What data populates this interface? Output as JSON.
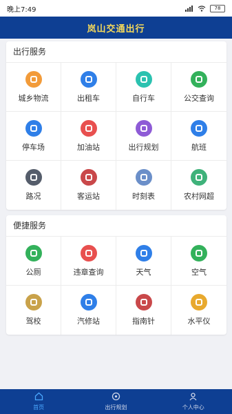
{
  "status_bar": {
    "time": "晚上7:49",
    "battery": "78"
  },
  "header": {
    "title": "岚山交通出行"
  },
  "sections": [
    {
      "title": "出行服务",
      "items": [
        {
          "label": "城乡物流",
          "icon": "logistics-icon",
          "color": "#f29b3a"
        },
        {
          "label": "出租车",
          "icon": "taxi-icon",
          "color": "#2f7fe8"
        },
        {
          "label": "自行车",
          "icon": "bicycle-icon",
          "color": "#2bc2b0"
        },
        {
          "label": "公交查询",
          "icon": "bus-icon",
          "color": "#33b15b"
        },
        {
          "label": "停车场",
          "icon": "parking-icon",
          "color": "#2f7fe8"
        },
        {
          "label": "加油站",
          "icon": "gas-station-icon",
          "color": "#e8504f"
        },
        {
          "label": "出行规划",
          "icon": "route-plan-icon",
          "color": "#8e5bd6"
        },
        {
          "label": "航班",
          "icon": "airplane-icon",
          "color": "#2f7fe8"
        },
        {
          "label": "路况",
          "icon": "traffic-light-icon",
          "color": "#555d6b"
        },
        {
          "label": "客运站",
          "icon": "coach-station-icon",
          "color": "#c9484a"
        },
        {
          "label": "时刻表",
          "icon": "timetable-icon",
          "color": "#6b8fc9"
        },
        {
          "label": "农村网超",
          "icon": "rural-market-icon",
          "color": "#3fb27a"
        }
      ]
    },
    {
      "title": "便捷服务",
      "items": [
        {
          "label": "公厕",
          "icon": "toilet-icon",
          "color": "#33b15b"
        },
        {
          "label": "违章查询",
          "icon": "violation-icon",
          "color": "#e8504f"
        },
        {
          "label": "天气",
          "icon": "weather-icon",
          "color": "#2f7fe8"
        },
        {
          "label": "空气",
          "icon": "air-icon",
          "color": "#33b15b"
        },
        {
          "label": "驾校",
          "icon": "driving-school-icon",
          "color": "#c9a24a"
        },
        {
          "label": "汽修站",
          "icon": "car-repair-icon",
          "color": "#2f7fe8"
        },
        {
          "label": "指南针",
          "icon": "compass-icon",
          "color": "#c9484a"
        },
        {
          "label": "水平仪",
          "icon": "level-icon",
          "color": "#e8a92e"
        }
      ]
    }
  ],
  "bottom_nav": [
    {
      "label": "首页",
      "icon": "home-icon",
      "active": true
    },
    {
      "label": "出行规划",
      "icon": "route-icon",
      "active": false
    },
    {
      "label": "个人中心",
      "icon": "person-icon",
      "active": false
    }
  ],
  "colors": {
    "header_bg": "#0e3f93",
    "title_text": "#f5d95a",
    "nav_active": "#4aa8ff"
  }
}
